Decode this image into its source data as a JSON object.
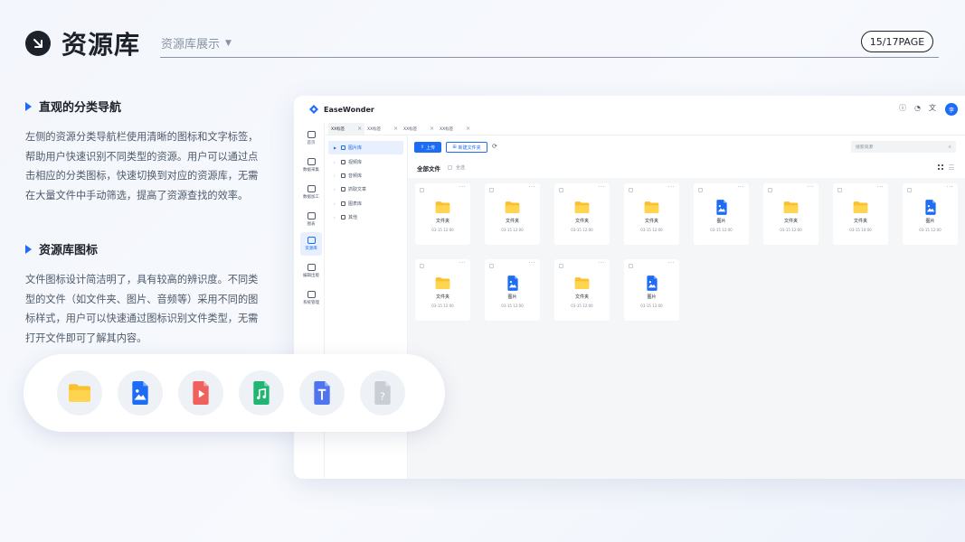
{
  "header": {
    "title": "资源库",
    "subtitle": "资源库展示",
    "page": "15/17PAGE"
  },
  "sections": [
    {
      "title": "直观的分类导航",
      "body": "左侧的资源分类导航栏使用清晰的图标和文字标签，帮助用户快速识别不同类型的资源。用户可以通过点击相应的分类图标，快速切换到对应的资源库，无需在大量文件中手动筛选，提高了资源查找的效率。"
    },
    {
      "title": "资源库图标",
      "body": "文件图标设计简洁明了，具有较高的辨识度。不同类型的文件（如文件夹、图片、音频等）采用不同的图标样式，用户可以快速通过图标识别文件类型，无需打开文件即可了解其内容。"
    }
  ],
  "icon_pill": [
    "folder-icon",
    "image-file-icon",
    "video-file-icon",
    "audio-file-icon",
    "text-file-icon",
    "unknown-file-icon"
  ],
  "app": {
    "brand": "EaseWonder",
    "avatar_text": "李",
    "nav": [
      "首页",
      "数据采集",
      "数据加工",
      "图表",
      "资源库",
      "编辑出版",
      "系统管理"
    ],
    "nav_active": 4,
    "tabs": [
      "XX标签",
      "XX标签",
      "XX标签",
      "XX标签"
    ],
    "tree": [
      "图片库",
      "视频库",
      "音频库",
      "抓取文章",
      "图表库",
      "其他"
    ],
    "toolbar": {
      "upload": "上传",
      "new_folder": "新建文件夹",
      "search_placeholder": "搜索资源"
    },
    "list_title": "全部文件",
    "select_all": "全选",
    "files": [
      {
        "type": "folder",
        "name": "文件夹",
        "date": "03-15 12:00"
      },
      {
        "type": "folder",
        "name": "文件夹",
        "date": "03-15 12:00"
      },
      {
        "type": "folder",
        "name": "文件夹",
        "date": "03-15 12:00"
      },
      {
        "type": "folder",
        "name": "文件夹",
        "date": "03-15 12:00"
      },
      {
        "type": "image",
        "name": "图片",
        "date": "03-15 12:00"
      },
      {
        "type": "folder",
        "name": "文件夹",
        "date": "03-15 12:00"
      },
      {
        "type": "folder",
        "name": "文件夹",
        "date": "03-15 10:00"
      },
      {
        "type": "image",
        "name": "图片",
        "date": "03-15 12:00"
      },
      {
        "type": "folder",
        "name": "文件夹",
        "date": "03-15 12:00"
      },
      {
        "type": "image",
        "name": "图片",
        "date": "03-15 12:00"
      },
      {
        "type": "folder",
        "name": "文件夹",
        "date": "03-15 12:00"
      },
      {
        "type": "image",
        "name": "图片",
        "date": "03-15 12:00"
      }
    ]
  },
  "colors": {
    "accent": "#1d6cf5",
    "folder": "#fbc02d",
    "video": "#f0605d",
    "audio": "#21b573",
    "text": "#4f74f0",
    "unknown": "#c9cdd4"
  }
}
